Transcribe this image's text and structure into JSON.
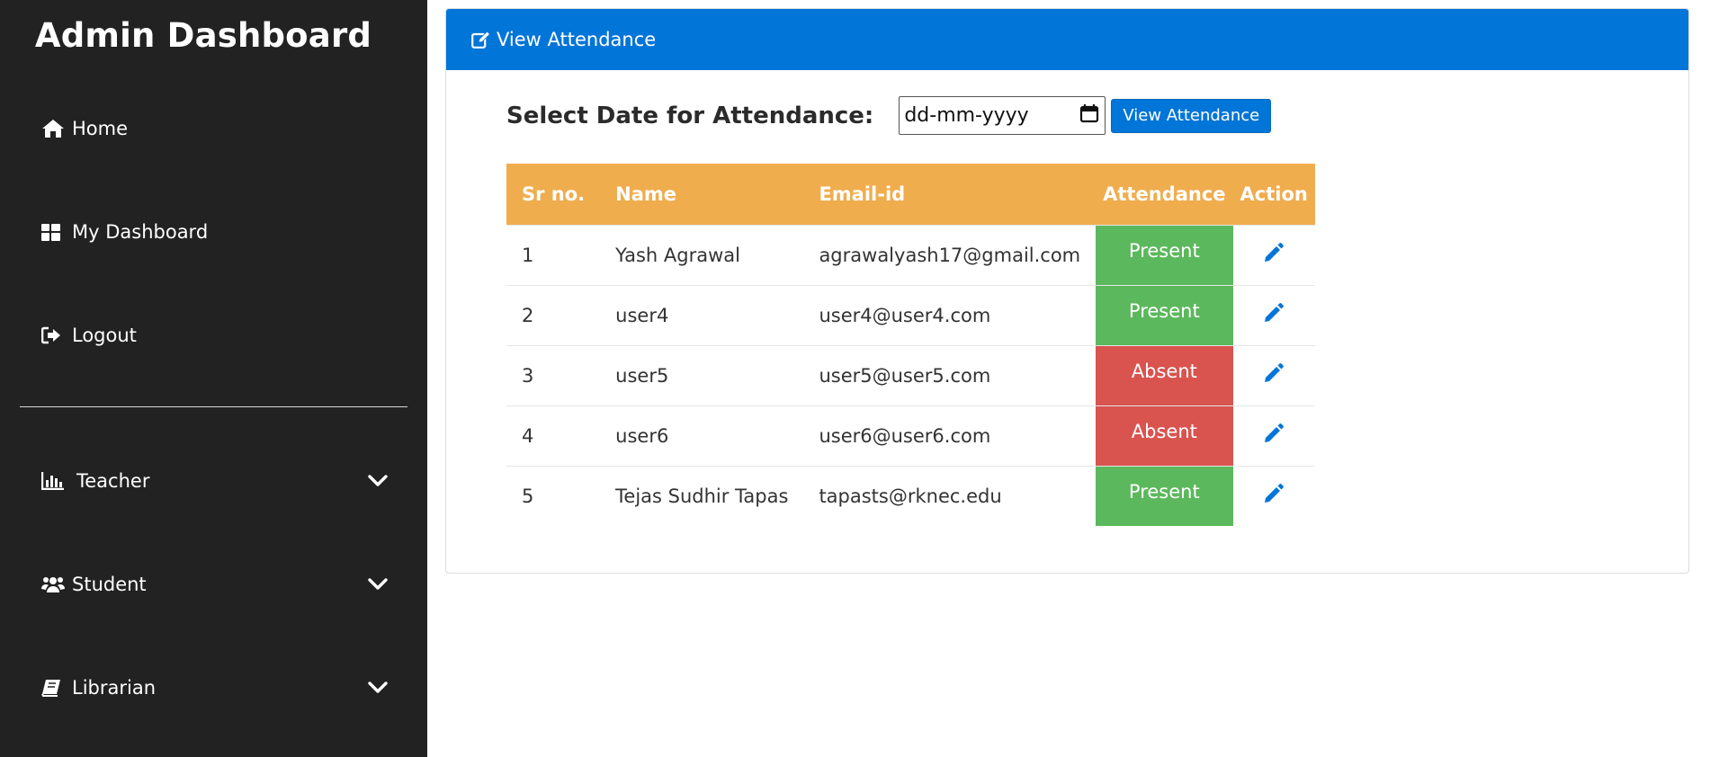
{
  "sidebar": {
    "brand": "Admin Dashboard",
    "items": [
      {
        "label": "Home",
        "icon": "home-icon"
      },
      {
        "label": "My Dashboard",
        "icon": "dashboard-grid-icon"
      },
      {
        "label": "Logout",
        "icon": "sign-out-icon"
      },
      {
        "label": "Teacher",
        "icon": "bar-chart-icon",
        "expandable": true
      },
      {
        "label": "Student",
        "icon": "users-icon",
        "expandable": true
      },
      {
        "label": "Librarian",
        "icon": "book-icon",
        "expandable": true
      }
    ]
  },
  "card": {
    "title": "View Attendance",
    "icon": "edit-square-icon"
  },
  "filter": {
    "label": "Select Date for Attendance:",
    "date_placeholder": "dd-mm-yyyy",
    "button_label": "View Attendance"
  },
  "table": {
    "headers": [
      "Sr no.",
      "Name",
      "Email-id",
      "Attendance",
      "Action"
    ],
    "rows": [
      {
        "sr": "1",
        "name": "Yash Agrawal",
        "email": "agrawalyash17@gmail.com",
        "attendance": "Present"
      },
      {
        "sr": "2",
        "name": "user4",
        "email": "user4@user4.com",
        "attendance": "Present"
      },
      {
        "sr": "3",
        "name": "user5",
        "email": "user5@user5.com",
        "attendance": "Absent"
      },
      {
        "sr": "4",
        "name": "user6",
        "email": "user6@user6.com",
        "attendance": "Absent"
      },
      {
        "sr": "5",
        "name": "Tejas Sudhir Tapas",
        "email": "tapasts@rknec.edu",
        "attendance": "Present"
      }
    ]
  },
  "colors": {
    "sidebar_bg": "#222222",
    "primary": "#0275d8",
    "table_header": "#f0ad4e",
    "present": "#5cb85c",
    "absent": "#d9534f"
  }
}
